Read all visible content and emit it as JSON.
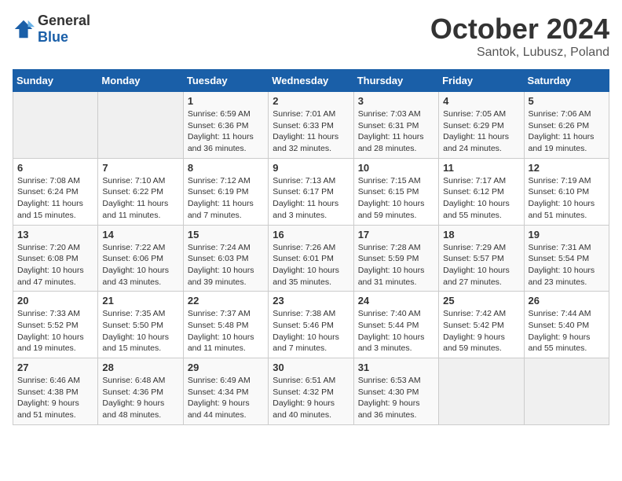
{
  "header": {
    "logo_general": "General",
    "logo_blue": "Blue",
    "title": "October 2024",
    "subtitle": "Santok, Lubusz, Poland"
  },
  "weekdays": [
    "Sunday",
    "Monday",
    "Tuesday",
    "Wednesday",
    "Thursday",
    "Friday",
    "Saturday"
  ],
  "weeks": [
    [
      {
        "day": "",
        "info": ""
      },
      {
        "day": "",
        "info": ""
      },
      {
        "day": "1",
        "info": "Sunrise: 6:59 AM\nSunset: 6:36 PM\nDaylight: 11 hours and 36 minutes."
      },
      {
        "day": "2",
        "info": "Sunrise: 7:01 AM\nSunset: 6:33 PM\nDaylight: 11 hours and 32 minutes."
      },
      {
        "day": "3",
        "info": "Sunrise: 7:03 AM\nSunset: 6:31 PM\nDaylight: 11 hours and 28 minutes."
      },
      {
        "day": "4",
        "info": "Sunrise: 7:05 AM\nSunset: 6:29 PM\nDaylight: 11 hours and 24 minutes."
      },
      {
        "day": "5",
        "info": "Sunrise: 7:06 AM\nSunset: 6:26 PM\nDaylight: 11 hours and 19 minutes."
      }
    ],
    [
      {
        "day": "6",
        "info": "Sunrise: 7:08 AM\nSunset: 6:24 PM\nDaylight: 11 hours and 15 minutes."
      },
      {
        "day": "7",
        "info": "Sunrise: 7:10 AM\nSunset: 6:22 PM\nDaylight: 11 hours and 11 minutes."
      },
      {
        "day": "8",
        "info": "Sunrise: 7:12 AM\nSunset: 6:19 PM\nDaylight: 11 hours and 7 minutes."
      },
      {
        "day": "9",
        "info": "Sunrise: 7:13 AM\nSunset: 6:17 PM\nDaylight: 11 hours and 3 minutes."
      },
      {
        "day": "10",
        "info": "Sunrise: 7:15 AM\nSunset: 6:15 PM\nDaylight: 10 hours and 59 minutes."
      },
      {
        "day": "11",
        "info": "Sunrise: 7:17 AM\nSunset: 6:12 PM\nDaylight: 10 hours and 55 minutes."
      },
      {
        "day": "12",
        "info": "Sunrise: 7:19 AM\nSunset: 6:10 PM\nDaylight: 10 hours and 51 minutes."
      }
    ],
    [
      {
        "day": "13",
        "info": "Sunrise: 7:20 AM\nSunset: 6:08 PM\nDaylight: 10 hours and 47 minutes."
      },
      {
        "day": "14",
        "info": "Sunrise: 7:22 AM\nSunset: 6:06 PM\nDaylight: 10 hours and 43 minutes."
      },
      {
        "day": "15",
        "info": "Sunrise: 7:24 AM\nSunset: 6:03 PM\nDaylight: 10 hours and 39 minutes."
      },
      {
        "day": "16",
        "info": "Sunrise: 7:26 AM\nSunset: 6:01 PM\nDaylight: 10 hours and 35 minutes."
      },
      {
        "day": "17",
        "info": "Sunrise: 7:28 AM\nSunset: 5:59 PM\nDaylight: 10 hours and 31 minutes."
      },
      {
        "day": "18",
        "info": "Sunrise: 7:29 AM\nSunset: 5:57 PM\nDaylight: 10 hours and 27 minutes."
      },
      {
        "day": "19",
        "info": "Sunrise: 7:31 AM\nSunset: 5:54 PM\nDaylight: 10 hours and 23 minutes."
      }
    ],
    [
      {
        "day": "20",
        "info": "Sunrise: 7:33 AM\nSunset: 5:52 PM\nDaylight: 10 hours and 19 minutes."
      },
      {
        "day": "21",
        "info": "Sunrise: 7:35 AM\nSunset: 5:50 PM\nDaylight: 10 hours and 15 minutes."
      },
      {
        "day": "22",
        "info": "Sunrise: 7:37 AM\nSunset: 5:48 PM\nDaylight: 10 hours and 11 minutes."
      },
      {
        "day": "23",
        "info": "Sunrise: 7:38 AM\nSunset: 5:46 PM\nDaylight: 10 hours and 7 minutes."
      },
      {
        "day": "24",
        "info": "Sunrise: 7:40 AM\nSunset: 5:44 PM\nDaylight: 10 hours and 3 minutes."
      },
      {
        "day": "25",
        "info": "Sunrise: 7:42 AM\nSunset: 5:42 PM\nDaylight: 9 hours and 59 minutes."
      },
      {
        "day": "26",
        "info": "Sunrise: 7:44 AM\nSunset: 5:40 PM\nDaylight: 9 hours and 55 minutes."
      }
    ],
    [
      {
        "day": "27",
        "info": "Sunrise: 6:46 AM\nSunset: 4:38 PM\nDaylight: 9 hours and 51 minutes."
      },
      {
        "day": "28",
        "info": "Sunrise: 6:48 AM\nSunset: 4:36 PM\nDaylight: 9 hours and 48 minutes."
      },
      {
        "day": "29",
        "info": "Sunrise: 6:49 AM\nSunset: 4:34 PM\nDaylight: 9 hours and 44 minutes."
      },
      {
        "day": "30",
        "info": "Sunrise: 6:51 AM\nSunset: 4:32 PM\nDaylight: 9 hours and 40 minutes."
      },
      {
        "day": "31",
        "info": "Sunrise: 6:53 AM\nSunset: 4:30 PM\nDaylight: 9 hours and 36 minutes."
      },
      {
        "day": "",
        "info": ""
      },
      {
        "day": "",
        "info": ""
      }
    ]
  ]
}
